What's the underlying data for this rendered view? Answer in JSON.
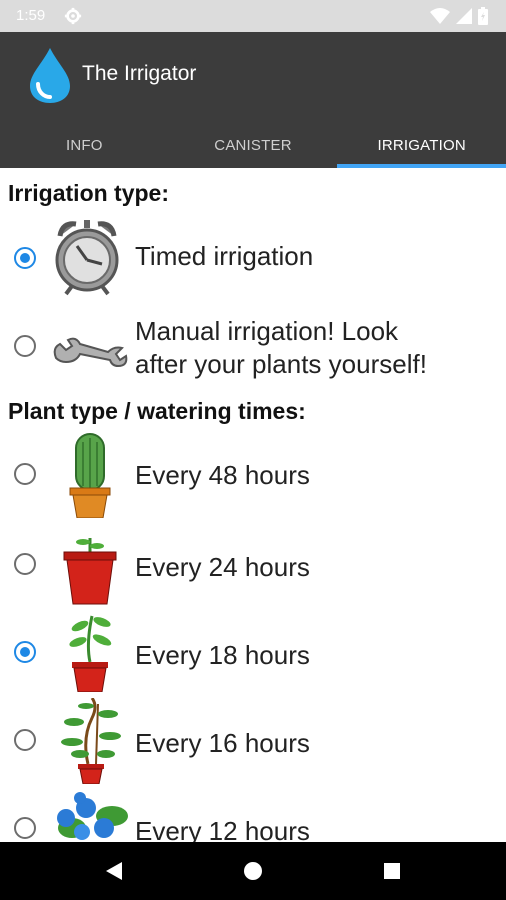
{
  "status_bar": {
    "time": "1:59"
  },
  "app": {
    "title": "The Irrigator"
  },
  "tabs": [
    {
      "label": "INFO",
      "active": false
    },
    {
      "label": "CANISTER",
      "active": false
    },
    {
      "label": "IRRIGATION",
      "active": true
    }
  ],
  "irrigation_type": {
    "heading": "Irrigation type:",
    "options": [
      {
        "label": "Timed irrigation",
        "selected": true,
        "icon": "alarm-clock-icon"
      },
      {
        "line1": "Manual irrigation! Look",
        "line2": "after your plants yourself!",
        "selected": false,
        "icon": "wrench-icon"
      }
    ]
  },
  "plant_type": {
    "heading": "Plant type / watering times:",
    "options": [
      {
        "label": "Every 48 hours",
        "selected": false,
        "icon": "cactus-icon"
      },
      {
        "label": "Every 24 hours",
        "selected": false,
        "icon": "sprout-pot-icon"
      },
      {
        "label": "Every 18 hours",
        "selected": true,
        "icon": "young-plant-icon"
      },
      {
        "label": "Every 16 hours",
        "selected": false,
        "icon": "climbing-plant-icon"
      },
      {
        "label": "Every 12 hours",
        "selected": false,
        "icon": "blue-flowers-icon"
      }
    ]
  },
  "colors": {
    "accent": "#1e88e5",
    "app_bar": "#3c3c3c",
    "tab_indicator": "#42a5f5"
  }
}
